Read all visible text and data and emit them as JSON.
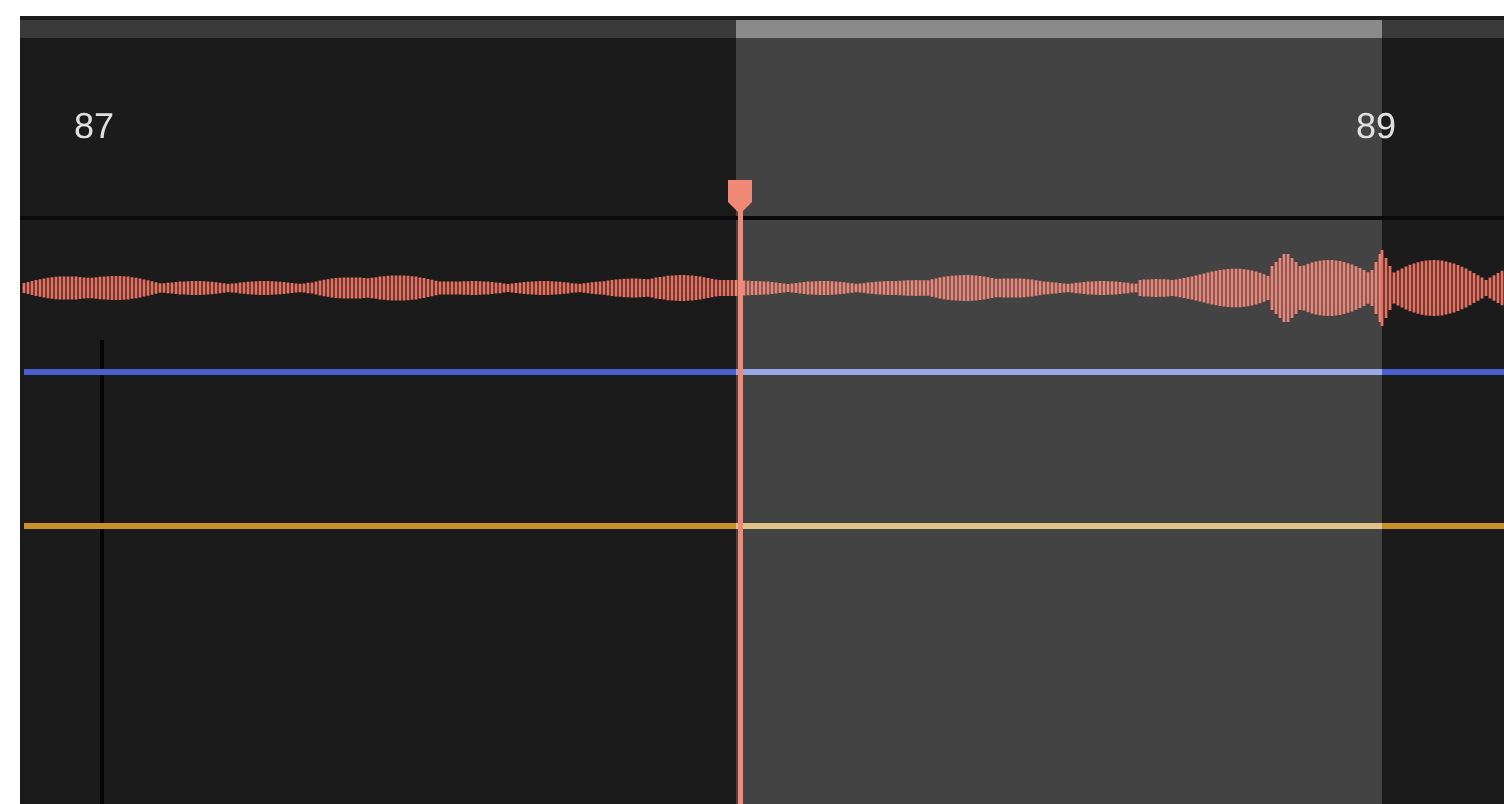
{
  "ruler": {
    "labels": [
      {
        "text": "87"
      },
      {
        "text": "89"
      }
    ]
  },
  "lanes": [
    {
      "kind": "audio",
      "color": "#e8705f"
    },
    {
      "kind": "automation",
      "color": "#4a5fcf"
    },
    {
      "kind": "automation",
      "color": "#c8902c"
    }
  ]
}
